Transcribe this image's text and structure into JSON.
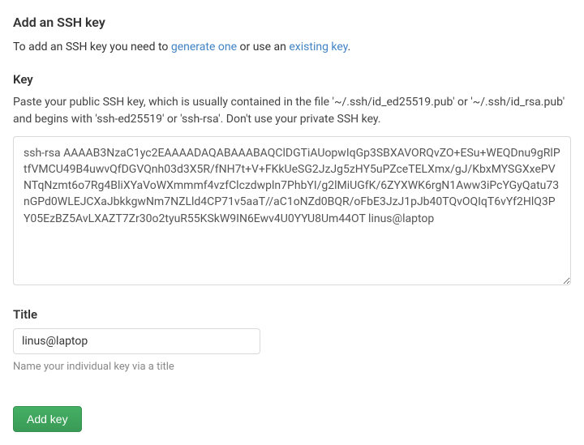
{
  "page": {
    "title": "Add an SSH key",
    "intro_prefix": "To add an SSH key you need to ",
    "intro_link1": "generate one",
    "intro_middle": " or use an ",
    "intro_link2": "existing key",
    "intro_suffix": "."
  },
  "key_field": {
    "label": "Key",
    "help": "Paste your public SSH key, which is usually contained in the file '~/.ssh/id_ed25519.pub' or '~/.ssh/id_rsa.pub' and begins with 'ssh-ed25519' or 'ssh-rsa'. Don't use your private SSH key.",
    "value": "ssh-rsa AAAAB3NzaC1yc2EAAAADAQABAAABAQClDGTiAUopwIqGp3SBXAVORQvZO+ESu+WEQDnu9gRlPtfVMCU49B4uwvQfDGVQnh03d3X5R/fNH7t+V+FKkUeSG2JzJg5zHY5uPZceTELXmx/gJ/KbxMYSGXxePVNTqNzmt6o7Rg4BliXYaVoWXmmmf4vzfClczdwpln7PhbYI/g2lMiUGfK/6ZYXWK6rgN1Aww3iPcYGyQatu73nGPd0WLEJCXaJbkkgwNm7NZLld4CP71v5aaT//aC1oNZd0BQR/oFbE3JzJ1pJb40TQvOQIqT6vYf2HlQ3PY05EzBZ5AvLXAZT7Zr30o2tyuR55KSkW9IN6Ewv4U0YYU8Um44OT linus@laptop"
  },
  "title_field": {
    "label": "Title",
    "value": "linus@laptop",
    "hint": "Name your individual key via a title"
  },
  "actions": {
    "submit_label": "Add key"
  }
}
